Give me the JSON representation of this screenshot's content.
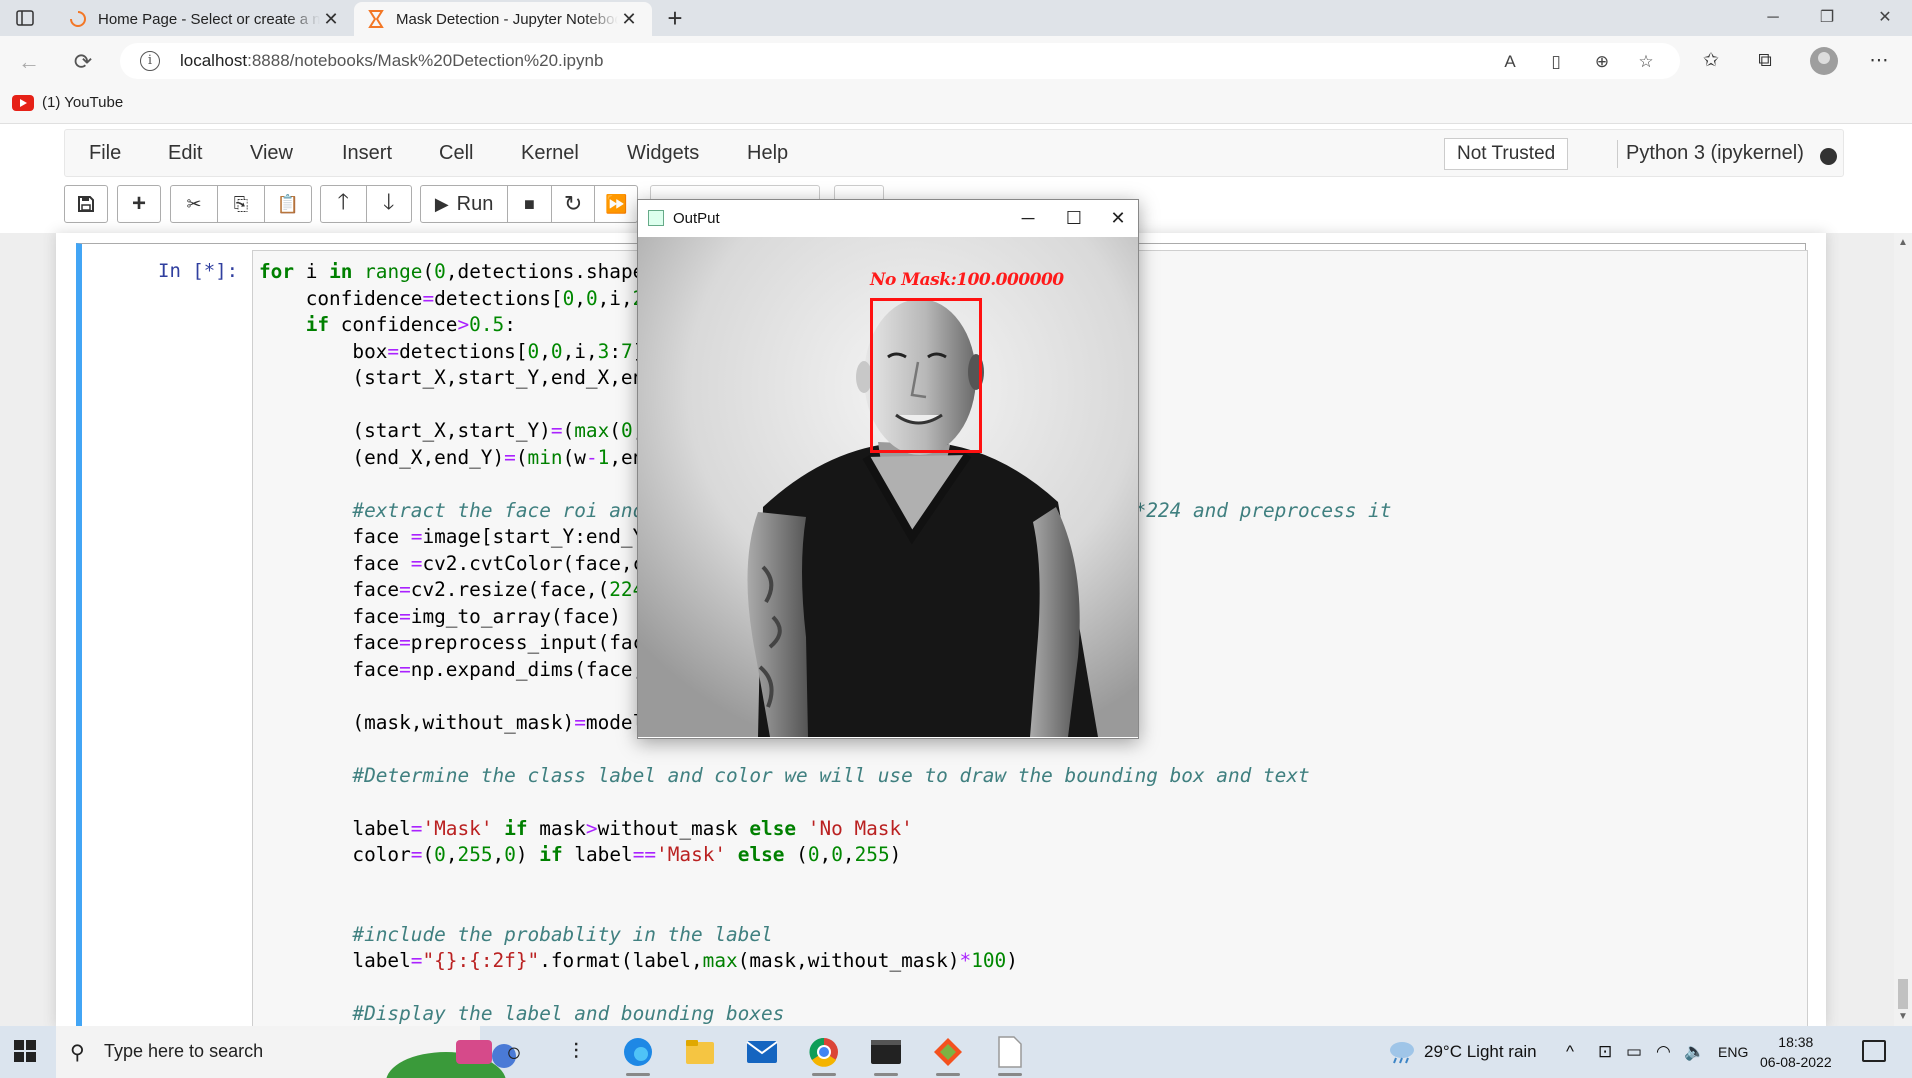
{
  "browser": {
    "tabs": [
      {
        "title": "Home Page - Select or create a notebook",
        "active": false
      },
      {
        "title": "Mask Detection - Jupyter Notebook",
        "active": true
      }
    ],
    "url_host": "localhost",
    "url_path": ":8888/notebooks/Mask%20Detection%20.ipynb",
    "bookmarks": [
      {
        "label": "(1) YouTube"
      }
    ]
  },
  "jupyter": {
    "menu": [
      "File",
      "Edit",
      "View",
      "Insert",
      "Cell",
      "Kernel",
      "Widgets",
      "Help"
    ],
    "trusted_label": "Not Trusted",
    "kernel_label": "Python 3 (ipykernel)",
    "run_label": "Run",
    "prompt": "In [*]:"
  },
  "output_window": {
    "title": "OutPut",
    "detection_label": "No Mask:100.000000",
    "box_color": "#ff1111"
  },
  "taskbar": {
    "search_placeholder": "Type here to search",
    "weather": "29°C  Light rain",
    "lang": "ENG",
    "time": "18:38",
    "date": "06-08-2022"
  },
  "colors": {
    "cell_accent": "#42a5f5",
    "prompt": "#303f9f",
    "keyword": "#008000",
    "string": "#ba2121",
    "comment": "#408080"
  }
}
